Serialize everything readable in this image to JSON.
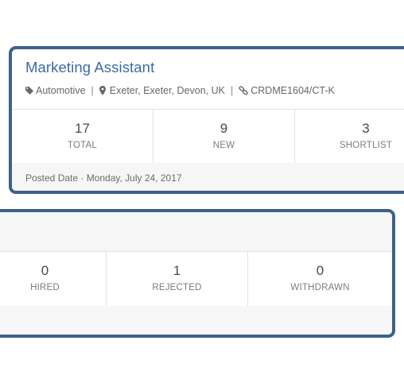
{
  "job": {
    "title": "Marketing Assistant",
    "industry": "Automotive",
    "location": "Exeter, Exeter, Devon, UK",
    "reference": "CRDME1604/CT-K",
    "separator": "|",
    "posted": "Posted Date · Monday, July 24, 2017"
  },
  "stats_top": [
    {
      "value": "17",
      "label": "TOTAL"
    },
    {
      "value": "9",
      "label": "NEW"
    },
    {
      "value": "3",
      "label": "SHORTLIST"
    }
  ],
  "stats_bottom": [
    {
      "value": "0",
      "label": "HIRED"
    },
    {
      "value": "1",
      "label": "REJECTED"
    },
    {
      "value": "0",
      "label": "WITHDRAWN"
    }
  ],
  "icons": {
    "industry": "tag-icon",
    "location": "map-marker-icon",
    "reference": "link-icon"
  },
  "colors": {
    "border": "#3d6089",
    "title": "#3b6aa5"
  }
}
